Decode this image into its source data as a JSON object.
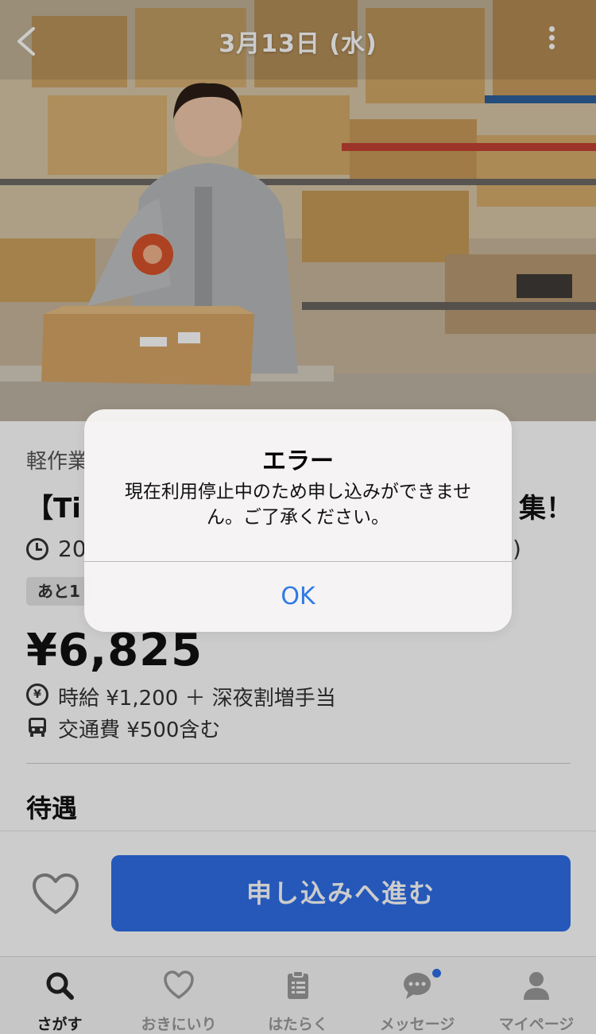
{
  "header": {
    "date_title": "3月13日 (水)"
  },
  "job": {
    "category": "軽作業",
    "title": "【Ti",
    "title_end": "集！",
    "time_text": "20",
    "time_paren": ")",
    "badge": "あと1",
    "price": "¥6,825",
    "wage": "時給 ¥1,200 ＋ 深夜割増手当",
    "fare": "交通費 ¥500含む",
    "section_title": "待遇"
  },
  "action": {
    "apply_label": "申し込みへ進む"
  },
  "tabs": [
    {
      "label": "さがす",
      "icon": "search-icon",
      "active": true
    },
    {
      "label": "おきにいり",
      "icon": "heart-icon",
      "active": false
    },
    {
      "label": "はたらく",
      "icon": "clipboard-icon",
      "active": false
    },
    {
      "label": "メッセージ",
      "icon": "chat-bubble-icon",
      "active": false,
      "has_notification": true
    },
    {
      "label": "マイページ",
      "icon": "person-icon",
      "active": false
    }
  ],
  "alert": {
    "title": "エラー",
    "message": "現在利用停止中のため申し込みができません。ご了承ください。",
    "ok_label": "OK"
  },
  "colors": {
    "primary": "#2f6fe8",
    "alert_button": "#2f7ae5",
    "notification_dot": "#2f6fe8"
  }
}
